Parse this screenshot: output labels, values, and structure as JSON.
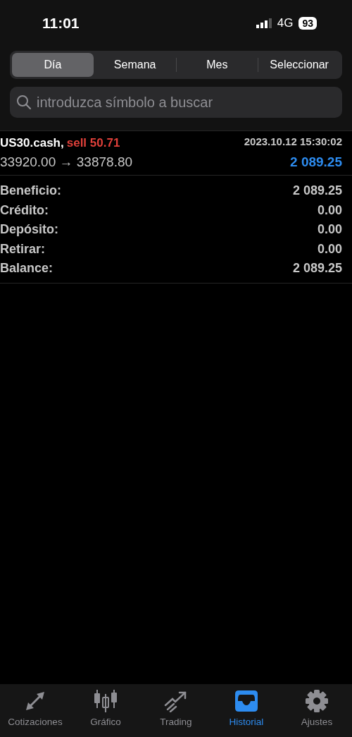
{
  "status_bar": {
    "time": "11:01",
    "network": "4G",
    "battery": "93"
  },
  "period_tabs": [
    {
      "label": "Día",
      "selected": true
    },
    {
      "label": "Semana",
      "selected": false
    },
    {
      "label": "Mes",
      "selected": false
    },
    {
      "label": "Seleccionar",
      "selected": false
    }
  ],
  "search": {
    "placeholder": "introduzca símbolo a buscar"
  },
  "deals": [
    {
      "symbol": "US30.cash,",
      "kind": "sell",
      "side": "sell 50.71",
      "time": "2023.10.12 15:30:02",
      "prices": "33920.00 → 33878.80",
      "profit": "2 089.25"
    }
  ],
  "summary": [
    {
      "label": "Beneficio:",
      "value": "2 089.25"
    },
    {
      "label": "Crédito:",
      "value": "0.00"
    },
    {
      "label": "Depósito:",
      "value": "0.00"
    },
    {
      "label": "Retirar:",
      "value": "0.00"
    },
    {
      "label": "Balance:",
      "value": "2 089.25"
    }
  ],
  "tab_bar": [
    {
      "kind": "quotes",
      "label": "Cotizaciones",
      "selected": false
    },
    {
      "kind": "chart",
      "label": "Gráfico",
      "selected": false
    },
    {
      "kind": "trading",
      "label": "Trading",
      "selected": false
    },
    {
      "kind": "history",
      "label": "Historial",
      "selected": true
    },
    {
      "kind": "settings",
      "label": "Ajustes",
      "selected": false
    }
  ]
}
